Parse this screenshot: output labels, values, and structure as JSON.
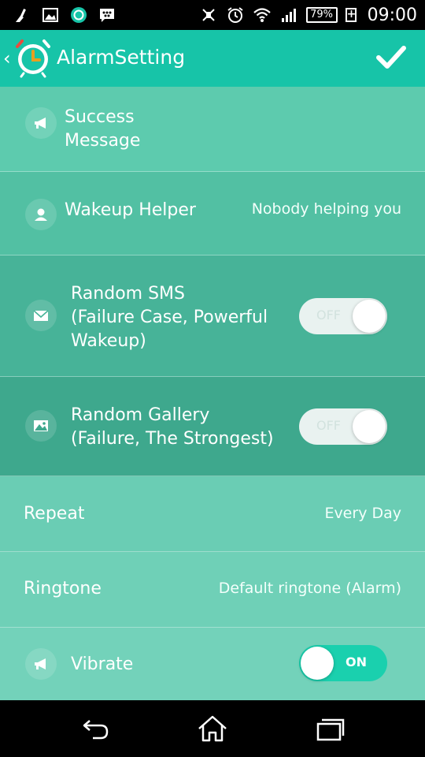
{
  "status_bar": {
    "battery_percent": "79%",
    "time": "09:00",
    "left_icons": [
      "cleaner-icon",
      "gallery-icon",
      "app-notification-icon",
      "messenger-icon"
    ],
    "right_icons": [
      "vibrate-icon",
      "alarm-icon",
      "wifi-icon",
      "signal-icon"
    ]
  },
  "app_bar": {
    "title": "AlarmSetting",
    "accent_color": "#17c4a8"
  },
  "settings": {
    "success_message": {
      "label_line1": "Success",
      "label_line2": "Message",
      "icon": "megaphone-icon"
    },
    "wakeup_helper": {
      "label": "Wakeup Helper",
      "value": "Nobody helping you",
      "icon": "person-icon"
    },
    "random_sms": {
      "label_line1": "Random SMS",
      "label_line2": "(Failure Case, Powerful",
      "label_line3": "Wakeup)",
      "toggle": "OFF",
      "icon": "envelope-icon"
    },
    "random_gallery": {
      "label_line1": "Random Gallery",
      "label_line2": "(Failure, The Strongest)",
      "toggle": "OFF",
      "icon": "image-icon"
    },
    "repeat": {
      "label": "Repeat",
      "value": "Every Day"
    },
    "ringtone": {
      "label": "Ringtone",
      "value": "Default ringtone (Alarm)"
    },
    "vibrate": {
      "label": "Vibrate",
      "toggle": "ON",
      "icon": "megaphone-icon"
    }
  },
  "row_colors": {
    "success": "#5dcbae",
    "wakeup": "#52c0a3",
    "sms": "#47b398",
    "gallery": "#3ea88d",
    "repeat": "#6acdb4",
    "ringtone": "#6fd0b7",
    "vibrate": "#73d2ba"
  },
  "nav_bar": {
    "icons": [
      "back-icon",
      "home-icon",
      "recent-apps-icon"
    ]
  }
}
